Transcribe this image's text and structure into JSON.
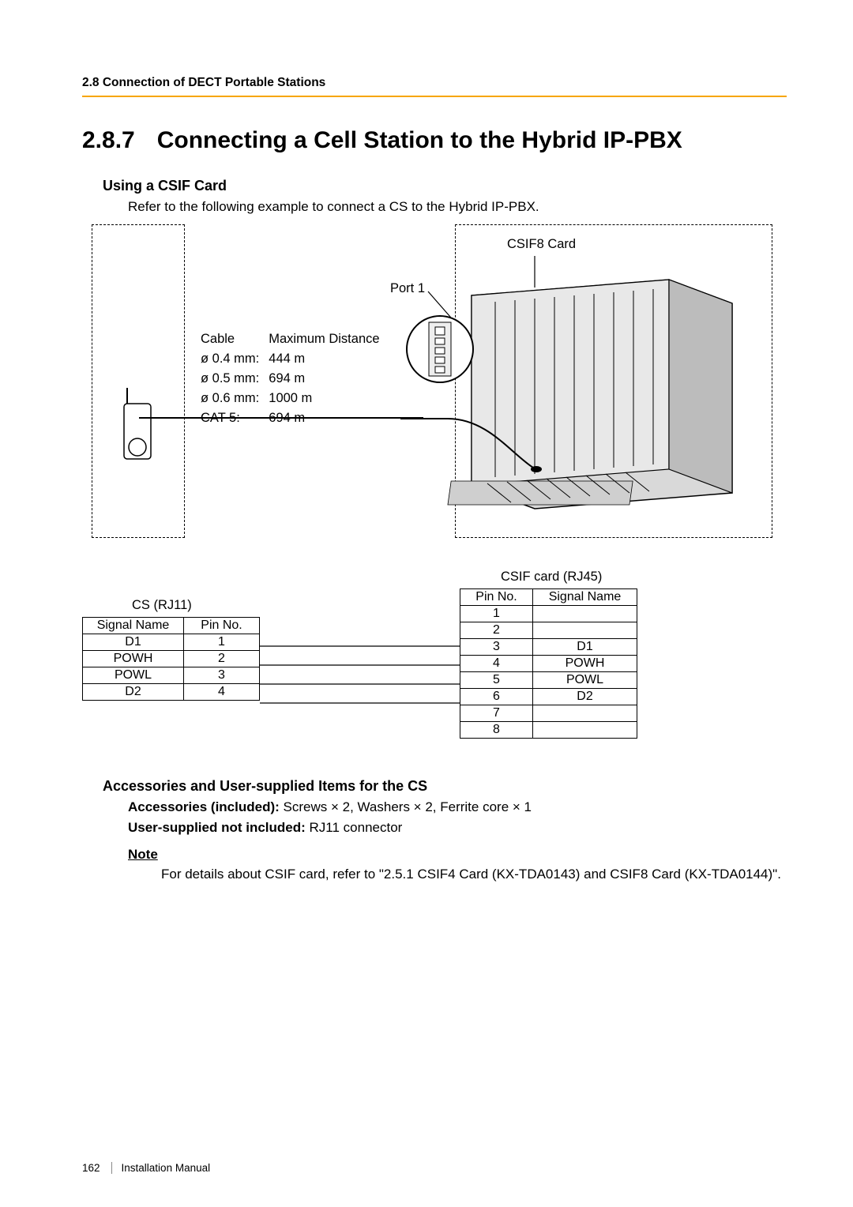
{
  "header": {
    "running": "2.8 Connection of DECT Portable Stations"
  },
  "section": {
    "number": "2.8.7",
    "title": "Connecting a Cell Station to the Hybrid IP-PBX"
  },
  "csif": {
    "heading": "Using a CSIF Card",
    "intro": "Refer to the following example to connect a CS to the Hybrid IP-PBX.",
    "card_label": "CSIF8 Card",
    "port_label": "Port 1",
    "cable_header": {
      "c1": "Cable",
      "c2": "Maximum Distance"
    },
    "cables": [
      {
        "c": "ø 0.4 mm:",
        "d": "444 m"
      },
      {
        "c": "ø 0.5 mm:",
        "d": "694 m"
      },
      {
        "c": "ø 0.6 mm:",
        "d": "1000 m"
      },
      {
        "c": "CAT 5:",
        "d": "694 m"
      }
    ]
  },
  "pins": {
    "cs_caption": "CS (RJ11)",
    "csif_caption": "CSIF card (RJ45)",
    "cs_headers": {
      "a": "Signal Name",
      "b": "Pin No."
    },
    "csif_headers": {
      "a": "Pin No.",
      "b": "Signal Name"
    },
    "cs_rows": [
      {
        "sig": "D1",
        "pin": "1"
      },
      {
        "sig": "POWH",
        "pin": "2"
      },
      {
        "sig": "POWL",
        "pin": "3"
      },
      {
        "sig": "D2",
        "pin": "4"
      }
    ],
    "csif_rows": [
      {
        "pin": "1",
        "sig": ""
      },
      {
        "pin": "2",
        "sig": ""
      },
      {
        "pin": "3",
        "sig": "D1"
      },
      {
        "pin": "4",
        "sig": "POWH"
      },
      {
        "pin": "5",
        "sig": "POWL"
      },
      {
        "pin": "6",
        "sig": "D2"
      },
      {
        "pin": "7",
        "sig": ""
      },
      {
        "pin": "8",
        "sig": ""
      }
    ]
  },
  "acc": {
    "heading": "Accessories and User-supplied Items for the CS",
    "inc_label": "Accessories (included): ",
    "inc_text": "Screws × 2, Washers × 2, Ferrite core × 1",
    "usr_label": "User-supplied not included: ",
    "usr_text": "RJ11 connector"
  },
  "note": {
    "label": "Note",
    "text": "For details about CSIF card, refer to \"2.5.1 CSIF4 Card (KX-TDA0143) and CSIF8 Card (KX-TDA0144)\"."
  },
  "footer": {
    "page": "162",
    "manual": "Installation Manual"
  },
  "chart_data": [
    {
      "type": "table",
      "title": "Cable maximum distance",
      "columns": [
        "Cable",
        "Maximum Distance"
      ],
      "rows": [
        [
          "ø 0.4 mm",
          "444 m"
        ],
        [
          "ø 0.5 mm",
          "694 m"
        ],
        [
          "ø 0.6 mm",
          "1000 m"
        ],
        [
          "CAT 5",
          "694 m"
        ]
      ]
    },
    {
      "type": "table",
      "title": "CS (RJ11) pinout",
      "columns": [
        "Signal Name",
        "Pin No."
      ],
      "rows": [
        [
          "D1",
          "1"
        ],
        [
          "POWH",
          "2"
        ],
        [
          "POWL",
          "3"
        ],
        [
          "D2",
          "4"
        ]
      ]
    },
    {
      "type": "table",
      "title": "CSIF card (RJ45) pinout",
      "columns": [
        "Pin No.",
        "Signal Name"
      ],
      "rows": [
        [
          "1",
          ""
        ],
        [
          "2",
          ""
        ],
        [
          "3",
          "D1"
        ],
        [
          "4",
          "POWH"
        ],
        [
          "5",
          "POWL"
        ],
        [
          "6",
          "D2"
        ],
        [
          "7",
          ""
        ],
        [
          "8",
          ""
        ]
      ]
    }
  ]
}
